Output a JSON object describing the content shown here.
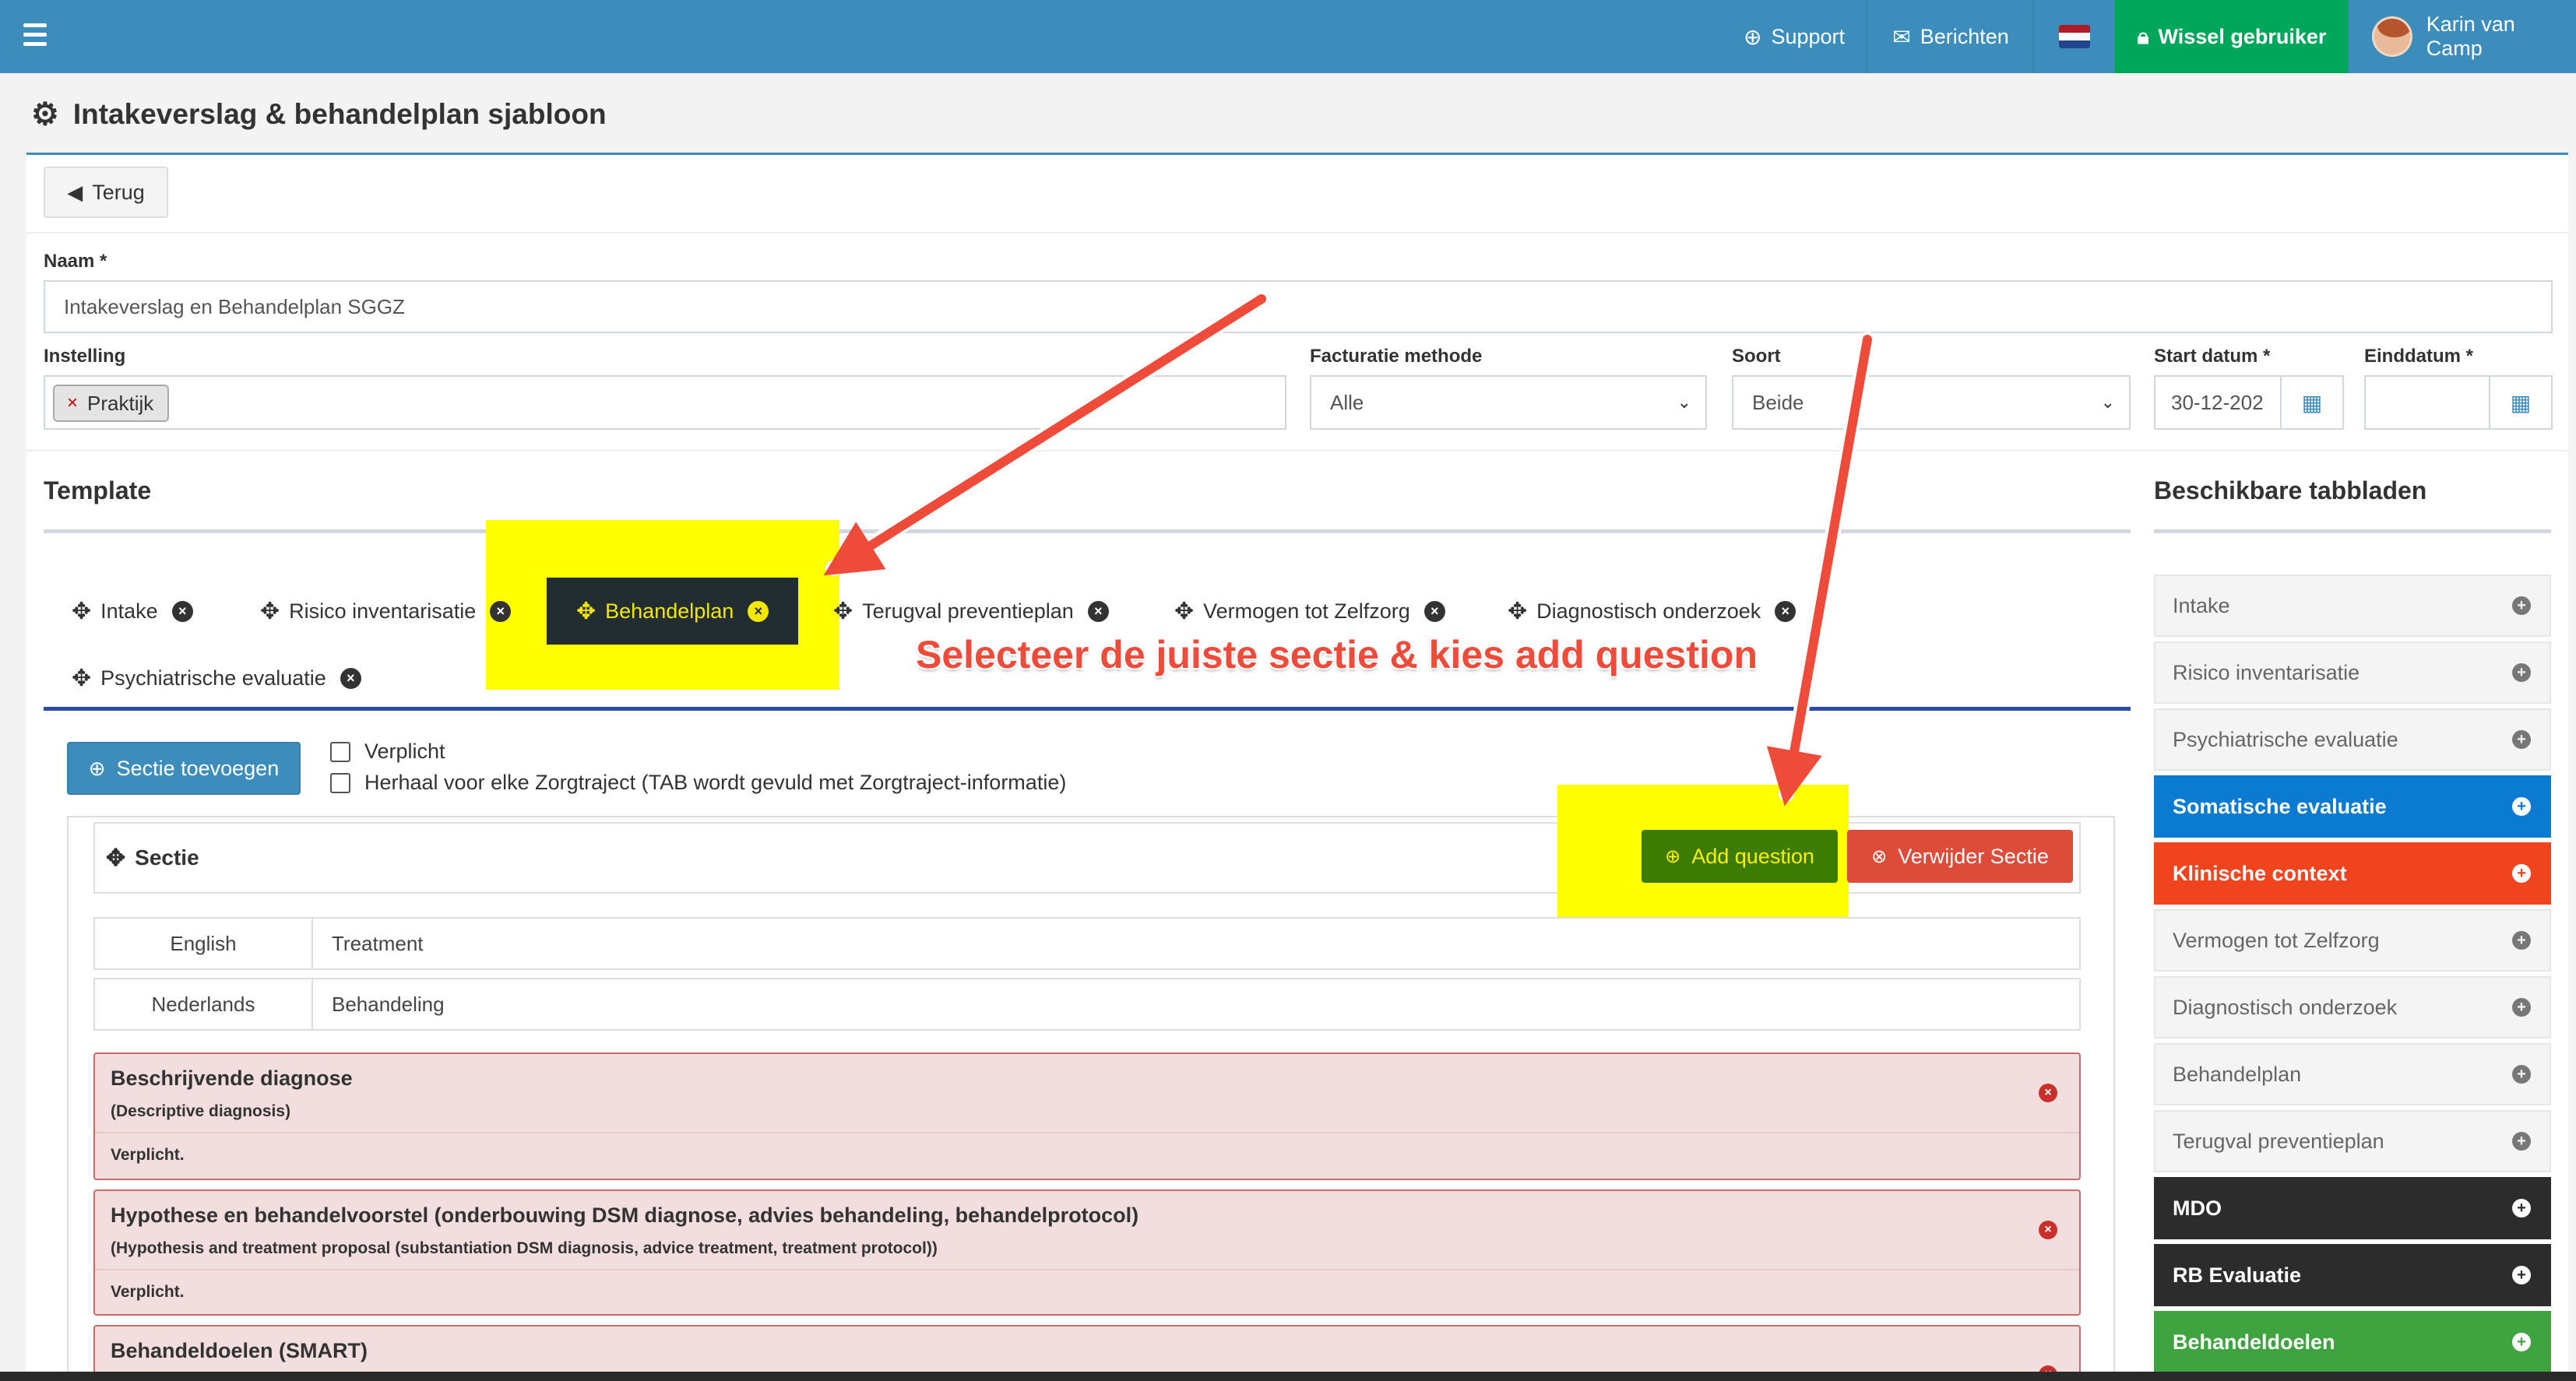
{
  "topbar": {
    "support": "Support",
    "berichten": "Berichten",
    "wissel": "Wissel gebruiker",
    "user": "Karin van Camp",
    "colors": {
      "bar": "#3c8dbc",
      "wissel": "#00a65a"
    },
    "icons": {
      "menu": "hamburger-menu-icon",
      "support": "lifebuoy-icon",
      "berichten": "envelope-icon",
      "flag": "netherlands-flag-icon",
      "wissel": "user-lock-icon"
    }
  },
  "page": {
    "title": "Intakeverslag & behandelplan sjabloon",
    "icon": "gear-icon"
  },
  "form": {
    "back_label": "Terug",
    "naam_label": "Naam *",
    "naam_value": "Intakeverslag en Behandelplan SGGZ",
    "instelling_label": "Instelling",
    "instelling_tag": "Praktijk",
    "facturatie_label": "Facturatie methode",
    "facturatie_value": "Alle",
    "soort_label": "Soort",
    "soort_value": "Beide",
    "start_label": "Start datum *",
    "start_value": "30-12-202",
    "eind_label": "Einddatum *",
    "eind_value": ""
  },
  "template": {
    "title": "Template",
    "tabs": [
      "Intake",
      "Risico inventarisatie",
      "Behandelplan",
      "Terugval preventieplan",
      "Vermogen tot Zelfzorg",
      "Diagnostisch onderzoek",
      "Psychiatrische evaluatie"
    ],
    "active_tab": "Behandelplan",
    "sectie_toevoegen": "Sectie toevoegen",
    "verplicht": "Verplicht",
    "herhaal": "Herhaal voor elke Zorgtraject (TAB wordt gevuld met Zorgtraject-informatie)",
    "sectie_title": "Sectie",
    "add_question": "Add question",
    "verwijder_sectie": "Verwijder Sectie",
    "languages": [
      {
        "lang": "English",
        "value": "Treatment"
      },
      {
        "lang": "Nederlands",
        "value": "Behandeling"
      }
    ],
    "questions": [
      {
        "title": "Beschrijvende diagnose",
        "subtitle": "(Descriptive diagnosis)",
        "req": "Verplicht."
      },
      {
        "title": "Hypothese en behandelvoorstel (onderbouwing DSM diagnose, advies behandeling, behandelprotocol)",
        "subtitle": "(Hypothesis and treatment proposal (substantiation DSM diagnosis, advice treatment, treatment protocol))",
        "req": "Verplicht."
      },
      {
        "title": "Behandeldoelen (SMART)"
      }
    ]
  },
  "available": {
    "title": "Beschikbare tabbladen",
    "items": [
      {
        "label": "Intake",
        "color": "#f4f4f4"
      },
      {
        "label": "Risico inventarisatie",
        "color": "#f4f4f4"
      },
      {
        "label": "Psychiatrische evaluatie",
        "color": "#f4f4f4"
      },
      {
        "label": "Somatische evaluatie",
        "color": "#0a7bd0"
      },
      {
        "label": "Klinische context",
        "color": "#f0441e"
      },
      {
        "label": "Vermogen tot Zelfzorg",
        "color": "#f4f4f4"
      },
      {
        "label": "Diagnostisch onderzoek",
        "color": "#f4f4f4"
      },
      {
        "label": "Behandelplan",
        "color": "#f4f4f4"
      },
      {
        "label": "Terugval preventieplan",
        "color": "#f4f4f4"
      },
      {
        "label": "MDO",
        "color": "#2c2c2c"
      },
      {
        "label": "RB Evaluatie",
        "color": "#2c2c2c"
      },
      {
        "label": "Behandeldoelen",
        "color": "#3fa43f"
      }
    ]
  },
  "annotation": {
    "text": "Selecteer de juiste sectie & kies add question",
    "color": "#ee4b3a",
    "highlight": "#ffff00"
  }
}
